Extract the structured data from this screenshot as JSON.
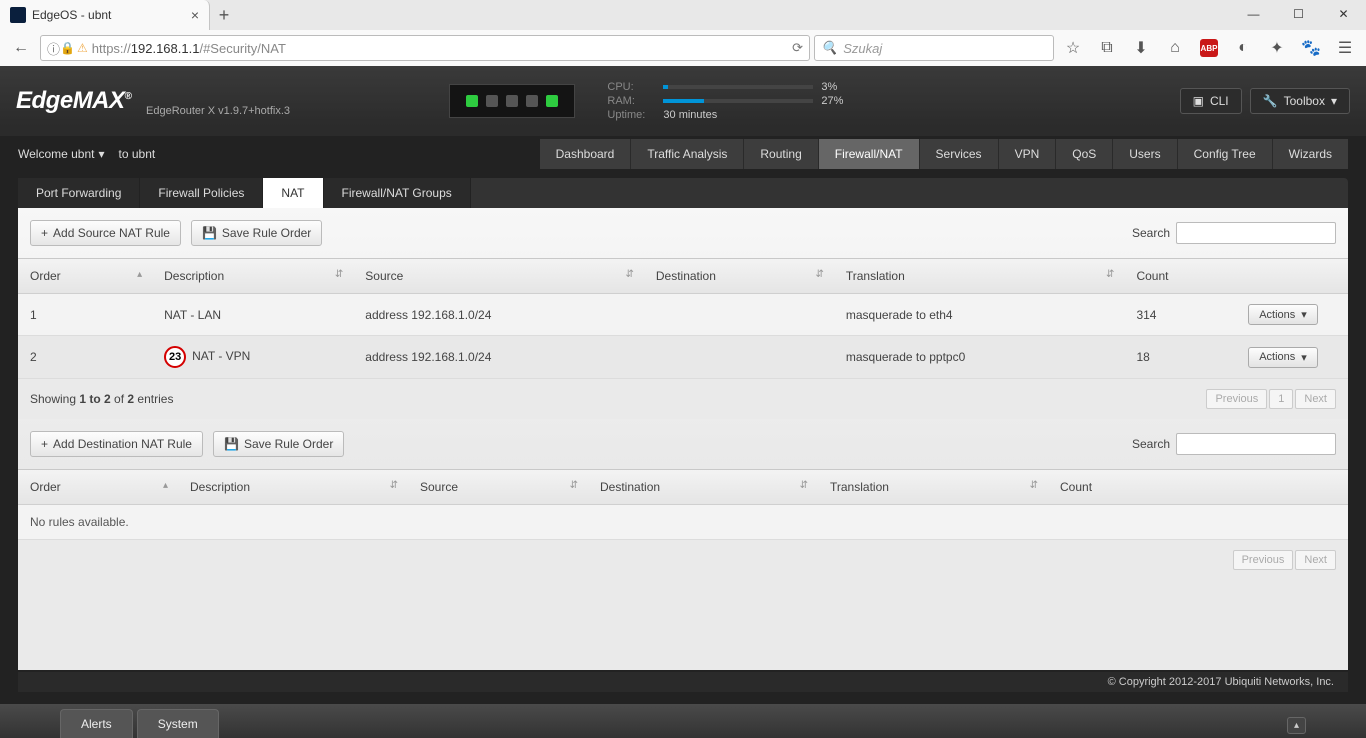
{
  "browser": {
    "tab_title": "EdgeOS - ubnt",
    "url_proto": "https://",
    "url_host": "192.168.1.1",
    "url_path": "/#Security/NAT",
    "search_placeholder": "Szukaj",
    "reload": "⟳"
  },
  "header": {
    "logo_a": "Edge",
    "logo_b": "MAX",
    "model": "EdgeRouter X v1.9.7+hotfix.3",
    "cpu_label": "CPU:",
    "cpu_pct": "3%",
    "ram_label": "RAM:",
    "ram_pct": "27%",
    "uptime_label": "Uptime:",
    "uptime_val": "30 minutes",
    "cli": "CLI",
    "toolbox": "Toolbox"
  },
  "subbar": {
    "welcome": "Welcome ubnt",
    "to": "to ubnt"
  },
  "main_tabs": [
    "Dashboard",
    "Traffic Analysis",
    "Routing",
    "Firewall/NAT",
    "Services",
    "VPN",
    "QoS",
    "Users",
    "Config Tree",
    "Wizards"
  ],
  "active_main": "Firewall/NAT",
  "sub_tabs": [
    "Port Forwarding",
    "Firewall Policies",
    "NAT",
    "Firewall/NAT Groups"
  ],
  "active_sub": "NAT",
  "source_nat": {
    "add_btn": "Add Source NAT Rule",
    "save_btn": "Save Rule Order",
    "search_label": "Search",
    "columns": [
      "Order",
      "Description",
      "Source",
      "Destination",
      "Translation",
      "Count",
      ""
    ],
    "rows": [
      {
        "order": "1",
        "desc": "NAT - LAN",
        "source": "address 192.168.1.0/24",
        "dest": "",
        "trans": "masquerade to eth4",
        "count": "314"
      },
      {
        "order": "2",
        "desc": "NAT - VPN",
        "source": "address 192.168.1.0/24",
        "dest": "",
        "trans": "masquerade to pptpc0",
        "count": "18"
      }
    ],
    "showing_pre": "Showing ",
    "showing_bold1": "1 to 2",
    "showing_mid": " of ",
    "showing_bold2": "2",
    "showing_post": " entries",
    "actions": "Actions",
    "previous": "Previous",
    "page1": "1",
    "next": "Next"
  },
  "dest_nat": {
    "add_btn": "Add Destination NAT Rule",
    "save_btn": "Save Rule Order",
    "search_label": "Search",
    "columns": [
      "Order",
      "Description",
      "Source",
      "Destination",
      "Translation",
      "Count"
    ],
    "no_rules": "No rules available.",
    "previous": "Previous",
    "next": "Next"
  },
  "footer": "© Copyright 2012-2017 Ubiquiti Networks, Inc.",
  "bottom_tabs": {
    "alerts": "Alerts",
    "system": "System"
  },
  "step23": "23",
  "icons": {
    "plus": "+",
    "save": "💾",
    "caret": "▾",
    "magnify": "🔍",
    "sort": "⇵",
    "sort_asc": "▴",
    "wrench": "🔧",
    "cli": "▣"
  }
}
